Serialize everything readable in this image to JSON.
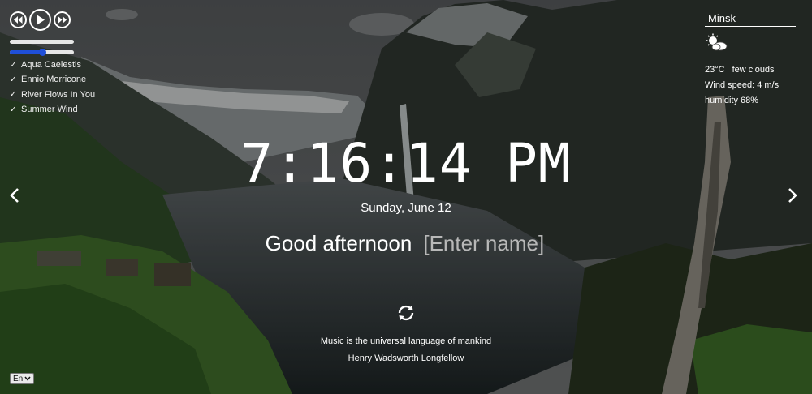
{
  "player": {
    "prev_icon": "rewind-icon",
    "play_icon": "play-icon",
    "next_icon": "fast-forward-icon",
    "volume": 0.5,
    "tracks": [
      "Aqua Caelestis",
      "Ennio Morricone",
      "River Flows In You",
      "Summer Wind"
    ]
  },
  "weather": {
    "city": "Minsk",
    "icon": "few-clouds-icon",
    "temperature": "23°C",
    "description": "few clouds",
    "wind": "Wind speed: 4 m/s",
    "humidity": "humidity 68%"
  },
  "clock": {
    "time": "7:16:14 PM",
    "date": "Sunday, June 12"
  },
  "greeting": {
    "text": "Good afternoon",
    "name_placeholder": "[Enter name]"
  },
  "quote": {
    "text": "Music is the universal language of mankind",
    "author": "Henry Wadsworth Longfellow"
  },
  "language": {
    "selected": "En"
  },
  "colors": {
    "accent": "#1f4fd8",
    "text": "#ffffff"
  }
}
